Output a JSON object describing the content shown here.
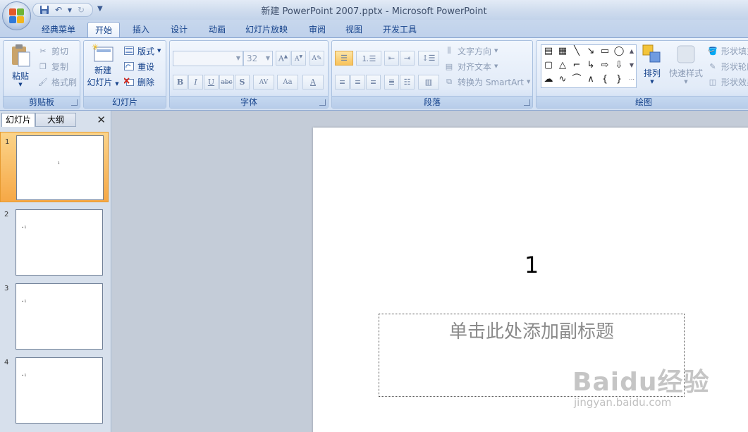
{
  "window": {
    "title": "新建 PowerPoint 2007.pptx - Microsoft PowerPoint"
  },
  "quick_access": {
    "icons": [
      "save-icon",
      "undo-icon",
      "redo-icon"
    ]
  },
  "tabs": [
    "经典菜单",
    "开始",
    "插入",
    "设计",
    "动画",
    "幻灯片放映",
    "审阅",
    "视图",
    "开发工具"
  ],
  "active_tab": "开始",
  "ribbon": {
    "clipboard": {
      "label": "剪贴板",
      "paste": "粘贴",
      "cut": "剪切",
      "copy": "复制",
      "format_painter": "格式刷"
    },
    "slides": {
      "label": "幻灯片",
      "new_slide_line1": "新建",
      "new_slide_line2": "幻灯片",
      "layout": "版式",
      "reset": "重设",
      "delete": "删除"
    },
    "font": {
      "label": "字体",
      "font_name": "",
      "font_size": "32",
      "bold": "B",
      "italic": "I",
      "underline": "U",
      "strike": "abc",
      "shadow": "S",
      "spacing": "AV",
      "case": "Aa",
      "color": "A"
    },
    "paragraph": {
      "label": "段落",
      "text_direction": "文字方向",
      "align_text": "对齐文本",
      "smartart": "转换为 SmartArt"
    },
    "drawing": {
      "label": "绘图",
      "arrange": "排列",
      "quick_styles": "快速样式",
      "shape_fill": "形状填充",
      "shape_outline": "形状轮廓",
      "shape_effects": "形状效果"
    }
  },
  "pane": {
    "tab_slides": "幻灯片",
    "tab_outline": "大纲"
  },
  "thumbnails": [
    {
      "num": "1",
      "text": "1"
    },
    {
      "num": "2",
      "text": "• 1"
    },
    {
      "num": "3",
      "text": "• 1"
    },
    {
      "num": "4",
      "text": "• 1"
    }
  ],
  "slide": {
    "title": "1",
    "subtitle_placeholder": "单击此处添加副标题"
  },
  "watermark": {
    "brand": "Baidu经验",
    "url": "jingyan.baidu.com"
  }
}
